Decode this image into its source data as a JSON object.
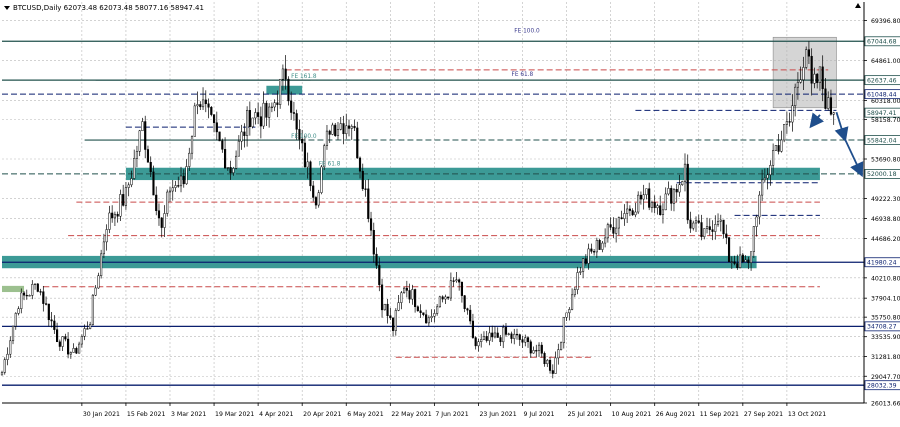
{
  "header": {
    "symbol_info": "BTCUSD,Daily  62073.48 62073.48 58077.16 58947.41"
  },
  "colors": {
    "background": "#ffffff",
    "grid": "#b8b8b8",
    "candle": "#000000",
    "teal_zone": "#3c9a96",
    "green_zone": "#9cc08f",
    "dark_line": "#21504c",
    "navy_line": "#0a1f6e",
    "red_dashed": "#c94a4a",
    "projection_arrow": "#1f4e8c",
    "highlight_box": "#b3b3b3",
    "fib_label": "#3d8c87",
    "fib_label_top": "#3a3a8c"
  },
  "chart_data": {
    "type": "candlestick",
    "title": "BTCUSD,Daily  62073.48 62073.48 58077.16 58947.41",
    "xlabel": "",
    "ylabel": "",
    "ylim": [
      26013.66,
      71500
    ],
    "grid": true,
    "y_ticks": [
      "69396.80",
      "64861.00",
      "60318.00",
      "58158.70",
      "53690.80",
      "49222.30",
      "46938.80",
      "44686.20",
      "40210.80",
      "37904.10",
      "35750.80",
      "33535.90",
      "31281.80",
      "29047.70",
      "26013.66"
    ],
    "x_ticks": [
      "30 Jan 2021",
      "15 Feb 2021",
      "3 Mar 2021",
      "19 Mar 2021",
      "4 Apr 2021",
      "20 Apr 2021",
      "6 May 2021",
      "22 May 2021",
      "7 Jun 2021",
      "23 Jun 2021",
      "9 Jul 2021",
      "25 Jul 2021",
      "10 Aug 2021",
      "26 Aug 2021",
      "11 Sep 2021",
      "27 Sep 2021",
      "13 Oct 2021"
    ],
    "price_labels": [
      {
        "value": 67044.68,
        "text": "67044.68",
        "style": "dark"
      },
      {
        "value": 62637.46,
        "text": "62637.46",
        "style": "dark"
      },
      {
        "value": 61048.44,
        "text": "61048.44",
        "style": "navy"
      },
      {
        "value": 58947.41,
        "text": "58947.41",
        "style": "dark"
      },
      {
        "value": 55842.04,
        "text": "55842.04",
        "style": "dark"
      },
      {
        "value": 52000.18,
        "text": "52000.18",
        "style": "dark"
      },
      {
        "value": 41980.24,
        "text": "41980.24",
        "style": "navy"
      },
      {
        "value": 34708.27,
        "text": "34708.27",
        "style": "navy"
      },
      {
        "value": 28032.39,
        "text": "28032.39",
        "style": "navy"
      }
    ],
    "fib_labels": [
      {
        "text": "FE 100.0",
        "value": 67800,
        "x": "2021-07-06",
        "style": "top"
      },
      {
        "text": "FE 161.8",
        "value": 62637.46,
        "x": "2021-04-16",
        "style": "teal"
      },
      {
        "text": "FE 61.8",
        "value": 62900,
        "x": "2021-07-05",
        "style": "top"
      },
      {
        "text": "FE 100.0",
        "value": 55842.04,
        "x": "2021-04-16",
        "style": "teal"
      },
      {
        "text": "FE 61.8",
        "value": 52700,
        "x": "2021-04-26",
        "style": "teal"
      }
    ],
    "zones": [
      {
        "name": "zone-teal-52k",
        "y1": 51300,
        "y2": 52700,
        "x1": "2021-02-15",
        "x2": "2021-10-25",
        "color": "teal_zone"
      },
      {
        "name": "zone-teal-42k",
        "y1": 41300,
        "y2": 42700,
        "x1": "2021-01-01",
        "x2": "2021-10-02",
        "color": "teal_zone"
      },
      {
        "name": "zone-teal-small",
        "y1": 61000,
        "y2": 62000,
        "x1": "2021-04-07",
        "x2": "2021-04-20",
        "color": "teal_zone"
      },
      {
        "name": "zone-green-38k",
        "y1": 38600,
        "y2": 39300,
        "x1": "2021-01-01",
        "x2": "2021-01-09",
        "color": "green_zone"
      },
      {
        "name": "highlight-box",
        "y1": 59500,
        "y2": 67500,
        "x1": "2021-10-08",
        "x2": "2021-10-31",
        "color": "highlight_box"
      }
    ],
    "hlines": [
      {
        "value": 67044.68,
        "color": "dark_line",
        "dash": false,
        "width": 1.3,
        "x1": "2021-01-01",
        "x2": "2021-12-31"
      },
      {
        "value": 62637.46,
        "color": "dark_line",
        "dash": false,
        "width": 1.3,
        "x1": "2021-01-01",
        "x2": "2021-12-31"
      },
      {
        "value": 62637.46,
        "color": "dark_line",
        "dash": false,
        "width": 1.1,
        "x1": "2021-02-04",
        "x2": "2021-04-23"
      },
      {
        "value": 55842.04,
        "color": "dark_line",
        "dash": false,
        "width": 1.1,
        "x1": "2021-01-31",
        "x2": "2021-04-19"
      },
      {
        "value": 55842.04,
        "color": "dark_line",
        "dash": true,
        "width": 1,
        "x1": "2021-04-19",
        "x2": "2021-12-31"
      },
      {
        "value": 52000.18,
        "color": "dark_line",
        "dash": true,
        "width": 1,
        "x1": "2021-01-01",
        "x2": "2021-12-31"
      },
      {
        "value": 61048.44,
        "color": "navy_line",
        "dash": true,
        "width": 1,
        "x1": "2021-01-01",
        "x2": "2021-12-31"
      },
      {
        "value": 41980.24,
        "color": "navy_line",
        "dash": false,
        "width": 1.3,
        "x1": "2021-01-01",
        "x2": "2021-12-31"
      },
      {
        "value": 34708.27,
        "color": "navy_line",
        "dash": false,
        "width": 1.3,
        "x1": "2021-01-01",
        "x2": "2021-12-31"
      },
      {
        "value": 28032.39,
        "color": "navy_line",
        "dash": false,
        "width": 1.3,
        "x1": "2021-01-01",
        "x2": "2021-12-31"
      },
      {
        "value": 59200,
        "color": "navy_line",
        "dash": true,
        "width": 1,
        "x1": "2021-08-19",
        "x2": "2021-10-31"
      },
      {
        "value": 57300,
        "color": "navy_line",
        "dash": true,
        "width": 1,
        "x1": "2021-02-15",
        "x2": "2021-04-03"
      },
      {
        "value": 51000,
        "color": "navy_line",
        "dash": true,
        "width": 1,
        "x1": "2021-09-03",
        "x2": "2021-10-25"
      },
      {
        "value": 47300,
        "color": "navy_line",
        "dash": true,
        "width": 1,
        "x1": "2021-09-24",
        "x2": "2021-10-25"
      },
      {
        "value": 63800,
        "color": "red_dashed",
        "dash": true,
        "width": 1,
        "x1": "2021-04-14",
        "x2": "2021-10-28"
      },
      {
        "value": 48800,
        "color": "red_dashed",
        "dash": true,
        "width": 1,
        "x1": "2021-01-28",
        "x2": "2021-10-25"
      },
      {
        "value": 45000,
        "color": "red_dashed",
        "dash": true,
        "width": 1,
        "x1": "2021-01-25",
        "x2": "2021-10-25"
      },
      {
        "value": 39200,
        "color": "red_dashed",
        "dash": true,
        "width": 1,
        "x1": "2021-01-16",
        "x2": "2021-10-25"
      },
      {
        "value": 31200,
        "color": "red_dashed",
        "dash": true,
        "width": 1,
        "x1": "2021-05-24",
        "x2": "2021-08-03"
      }
    ],
    "arrows": [
      {
        "from": [
          "2021-10-25",
          58700
        ],
        "to": [
          "2021-10-22",
          57500
        ]
      },
      {
        "from": [
          "2021-10-31",
          59000
        ],
        "to": [
          "2021-11-03",
          56000
        ]
      },
      {
        "from": [
          "2021-11-03",
          56000
        ],
        "to": [
          "2021-11-09",
          52000
        ]
      }
    ],
    "current_price": {
      "value": 58947.41,
      "text": "58947.41"
    },
    "anchors": [
      [
        "2021-01-01",
        29500
      ],
      [
        "2021-01-07",
        37500
      ],
      [
        "2021-01-14",
        39500
      ],
      [
        "2021-01-21",
        33500
      ],
      [
        "2021-01-27",
        31500
      ],
      [
        "2021-02-02",
        35500
      ],
      [
        "2021-02-08",
        46500
      ],
      [
        "2021-02-15",
        49500
      ],
      [
        "2021-02-21",
        57500
      ],
      [
        "2021-02-28",
        45500
      ],
      [
        "2021-03-03",
        50500
      ],
      [
        "2021-03-08",
        51000
      ],
      [
        "2021-03-13",
        61000
      ],
      [
        "2021-03-18",
        57500
      ],
      [
        "2021-03-25",
        52500
      ],
      [
        "2021-04-01",
        58800
      ],
      [
        "2021-04-08",
        58500
      ],
      [
        "2021-04-14",
        63500
      ],
      [
        "2021-04-18",
        56500
      ],
      [
        "2021-04-25",
        49500
      ],
      [
        "2021-04-30",
        57500
      ],
      [
        "2021-05-08",
        58000
      ],
      [
        "2021-05-13",
        50000
      ],
      [
        "2021-05-19",
        37500
      ],
      [
        "2021-05-23",
        34500
      ],
      [
        "2021-05-27",
        39500
      ],
      [
        "2021-06-05",
        35500
      ],
      [
        "2021-06-15",
        40000
      ],
      [
        "2021-06-22",
        32500
      ],
      [
        "2021-07-02",
        33800
      ],
      [
        "2021-07-08",
        33200
      ],
      [
        "2021-07-15",
        31800
      ],
      [
        "2021-07-20",
        29800
      ],
      [
        "2021-07-26",
        37500
      ],
      [
        "2021-07-30",
        41500
      ],
      [
        "2021-08-07",
        44500
      ],
      [
        "2021-08-14",
        47500
      ],
      [
        "2021-08-22",
        49500
      ],
      [
        "2021-08-28",
        48500
      ],
      [
        "2021-09-03",
        50500
      ],
      [
        "2021-09-06",
        52500
      ],
      [
        "2021-09-07",
        46800
      ],
      [
        "2021-09-13",
        44800
      ],
      [
        "2021-09-18",
        47500
      ],
      [
        "2021-09-22",
        42500
      ],
      [
        "2021-09-29",
        41500
      ],
      [
        "2021-10-02",
        48000
      ],
      [
        "2021-10-08",
        54500
      ],
      [
        "2021-10-14",
        57800
      ],
      [
        "2021-10-16",
        61500
      ],
      [
        "2021-10-20",
        66500
      ],
      [
        "2021-10-22",
        61500
      ],
      [
        "2021-10-25",
        63000
      ],
      [
        "2021-10-28",
        59500
      ],
      [
        "2021-10-30",
        58947.41
      ]
    ]
  }
}
